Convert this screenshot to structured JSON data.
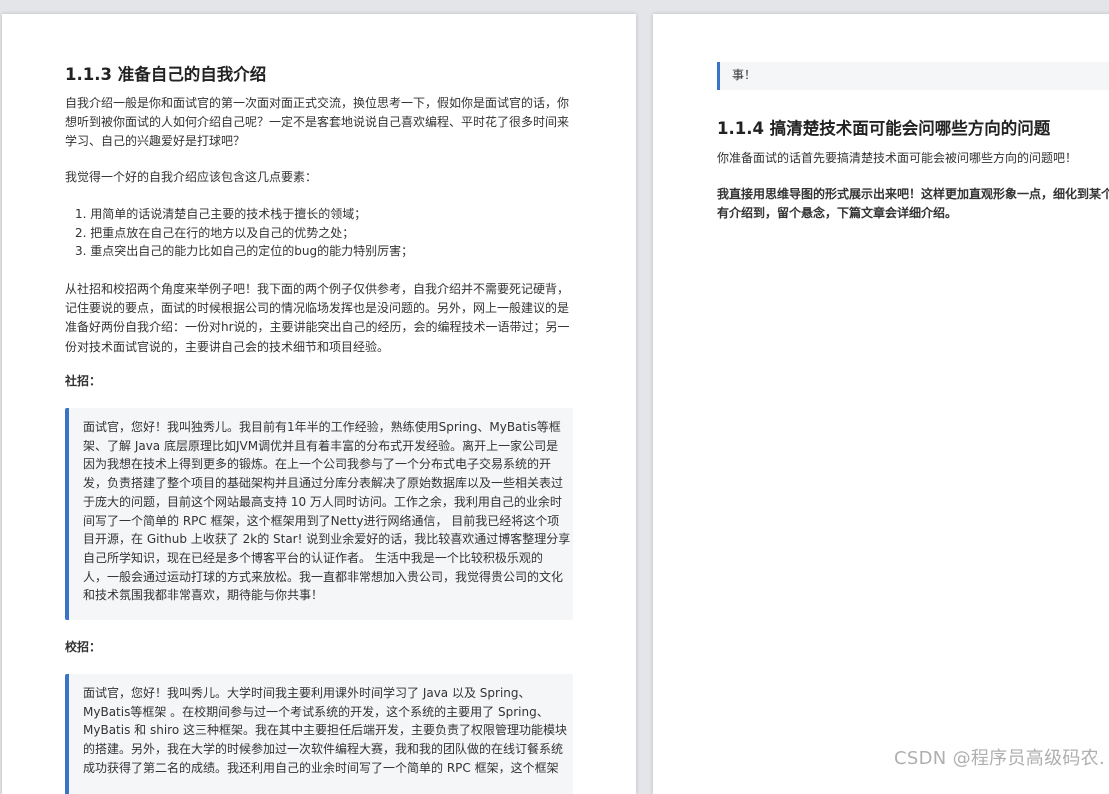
{
  "left_page": {
    "title": "1.1.3 准备自己的自我介绍",
    "intro_lines": [
      "自我介绍一般是你和面试官的第一次面对面正式交流，换位思考一下，假如你是面试官的话，你",
      "想听到被你面试的人如何介绍自己呢？一定不是客套地说说自己喜欢编程、平时花了很多时间来",
      "学习、自己的兴趣爱好是打球吧？"
    ],
    "elements_intro": "我觉得一个好的自我介绍应该包含这几点要素：",
    "points": [
      "1.  用简单的话说清楚自己主要的技术栈于擅长的领域；",
      "2.  把重点放在自己在行的地方以及自己的优势之处；",
      "3.  重点突出自己的能力比如自己的定位的bug的能力特别厉害；"
    ],
    "example_lines": [
      "从社招和校招两个角度来举例子吧！我下面的两个例子仅供参考，自我介绍并不需要死记硬背，",
      "记住要说的要点，面试的时候根据公司的情况临场发挥也是没问题的。另外，网上一般建议的是",
      "准备好两份自我介绍：一份对hr说的，主要讲能突出自己的经历，会的编程技术一语带过；另一",
      "份对技术面试官说的，主要讲自己会的技术细节和项目经验。"
    ],
    "social_label": "社招：",
    "social_quote_lines": [
      "面试官，您好！我叫独秀儿。我目前有1年半的工作经验，熟练使用Spring、MyBatis等框",
      "架、了解 Java 底层原理比如JVM调优并且有着丰富的分布式开发经验。离开上一家公司是",
      "因为我想在技术上得到更多的锻炼。在上一个公司我参与了一个分布式电子交易系统的开",
      "发，负责搭建了整个项目的基础架构并且通过分库分表解决了原始数据库以及一些相关表过",
      "于庞大的问题，目前这个网站最高支持 10 万人同时访问。工作之余，我利用自己的业余时",
      "间写了一个简单的 RPC 框架，这个框架用到了Netty进行网络通信， 目前我已经将这个项",
      "目开源，在 Github 上收获了 2k的 Star! 说到业余爱好的话，我比较喜欢通过博客整理分享",
      "自己所学知识，现在已经是多个博客平台的认证作者。 生活中我是一个比较积极乐观的",
      "人，一般会通过运动打球的方式来放松。我一直都非常想加入贵公司，我觉得贵公司的文化",
      "和技术氛围我都非常喜欢，期待能与你共事！"
    ],
    "campus_label": "校招：",
    "campus_quote_lines": [
      "面试官，您好！我叫秀儿。大学时间我主要利用课外时间学习了 Java 以及 Spring、",
      "MyBatis等框架 。在校期间参与过一个考试系统的开发，这个系统的主要用了 Spring、",
      "MyBatis 和 shiro 这三种框架。我在其中主要担任后端开发，主要负责了权限管理功能模块",
      "的搭建。另外，我在大学的时候参加过一次软件编程大赛，我和我的团队做的在线订餐系统",
      "成功获得了第二名的成绩。我还利用自己的业余时间写了一个简单的 RPC 框架，这个框架"
    ]
  },
  "right_page": {
    "quote_tail": "事！",
    "title": "1.1.4 搞清楚技术面可能会问哪些方向的问题",
    "intro": "你准备面试的话首先要搞清楚技术面可能会被问哪些方向的问题吧！",
    "bold_lines": [
      "我直接用思维导图的形式展示出来吧！这样更加直观形象一点，细化到某个",
      "有介绍到，留个悬念，下篇文章会详细介绍。"
    ]
  },
  "watermark": "CSDN @程序员高级码农.",
  "colors": {
    "quote_border": "#3b73c8",
    "quote_bg": "#f5f6f8",
    "page_bg": "#ffffff",
    "desk_bg": "#e4e5e9"
  }
}
